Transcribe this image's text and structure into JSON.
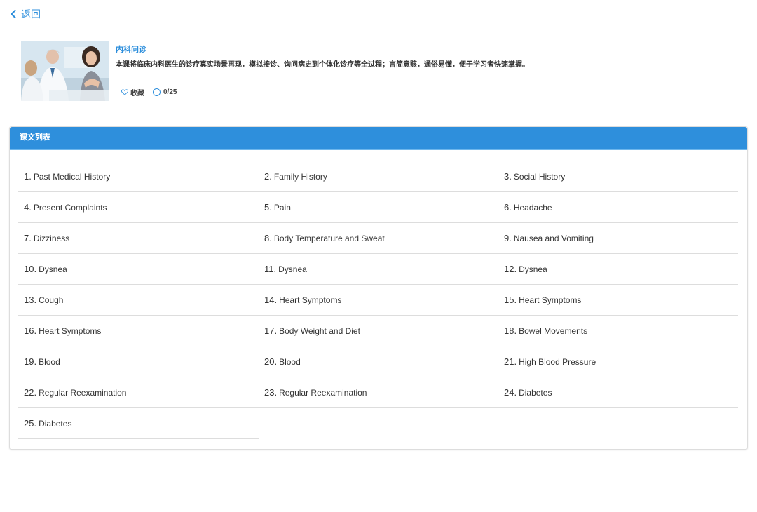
{
  "nav": {
    "back_label": "返回"
  },
  "course": {
    "title": "内科问诊",
    "description": "本课将临床内科医生的诊疗真实场景再现，模拟接诊、询问病史到个体化诊疗等全过程；言简意赅，通俗易懂，便于学习者快速掌握。",
    "favorite_label": "收藏",
    "progress_text": "0/25",
    "progress_fraction": 0
  },
  "panel": {
    "title": "课文列表"
  },
  "lessons": [
    {
      "num": "1.",
      "title": "Past Medical History"
    },
    {
      "num": "2.",
      "title": "Family History"
    },
    {
      "num": "3.",
      "title": "Social History"
    },
    {
      "num": "4.",
      "title": "Present Complaints"
    },
    {
      "num": "5.",
      "title": "Pain"
    },
    {
      "num": "6.",
      "title": "Headache"
    },
    {
      "num": "7.",
      "title": "Dizziness"
    },
    {
      "num": "8.",
      "title": "Body Temperature and Sweat"
    },
    {
      "num": "9.",
      "title": "Nausea and Vomiting"
    },
    {
      "num": "10.",
      "title": "Dysnea"
    },
    {
      "num": "11.",
      "title": "Dysnea"
    },
    {
      "num": "12.",
      "title": "Dysnea"
    },
    {
      "num": "13.",
      "title": "Cough"
    },
    {
      "num": "14.",
      "title": "Heart Symptoms"
    },
    {
      "num": "15.",
      "title": "Heart Symptoms"
    },
    {
      "num": "16.",
      "title": "Heart Symptoms"
    },
    {
      "num": "17.",
      "title": "Body Weight and Diet"
    },
    {
      "num": "18.",
      "title": "Bowel Movements"
    },
    {
      "num": "19.",
      "title": "Blood"
    },
    {
      "num": "20.",
      "title": "Blood"
    },
    {
      "num": "21.",
      "title": "High Blood Pressure"
    },
    {
      "num": "22.",
      "title": "Regular Reexamination"
    },
    {
      "num": "23.",
      "title": "Regular Reexamination"
    },
    {
      "num": "24.",
      "title": "Diabetes"
    },
    {
      "num": "25.",
      "title": "Diabetes"
    }
  ],
  "colors": {
    "accent": "#2e8fdc",
    "divider": "#dddddd"
  },
  "icons": {
    "back": "chevron-left-icon",
    "favorite": "heart-outline-icon",
    "progress": "circle-outline-icon"
  }
}
